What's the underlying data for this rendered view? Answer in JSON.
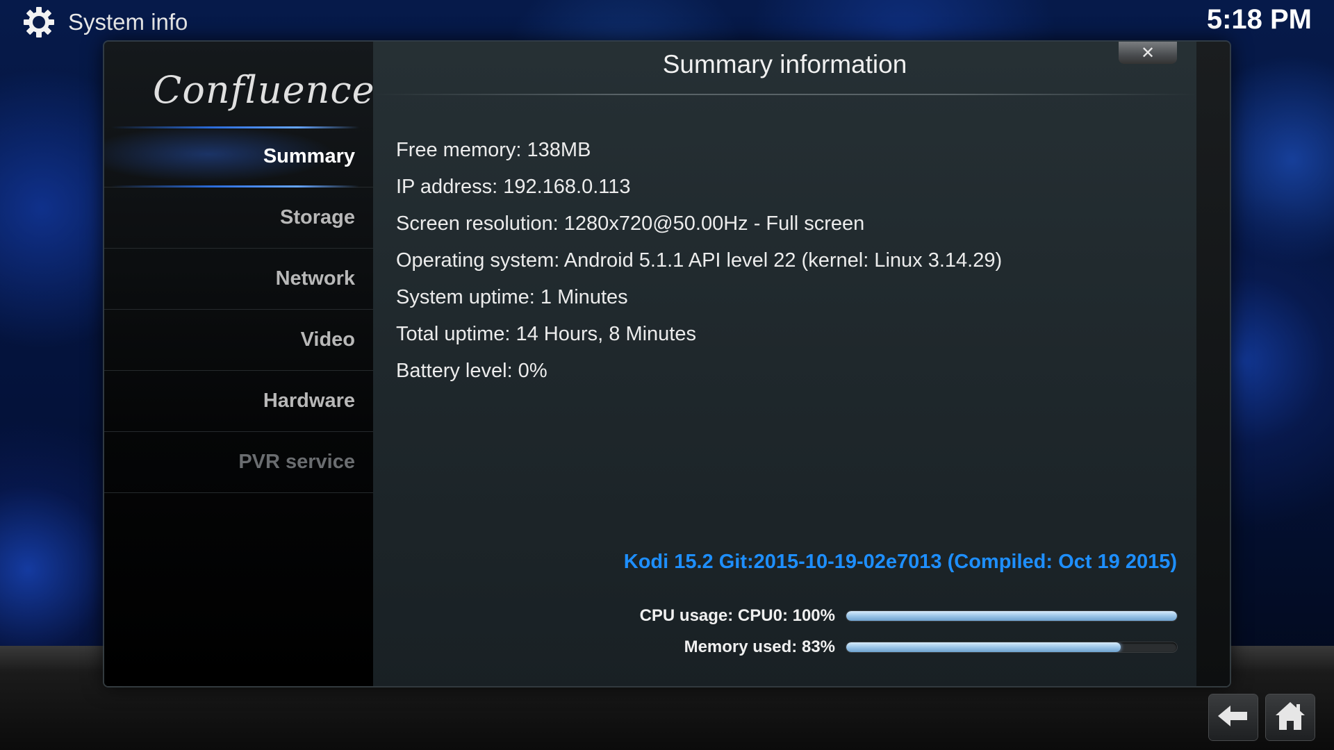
{
  "header": {
    "title": "System info",
    "time": "5:18 PM",
    "icon": "gear-icon"
  },
  "dialog": {
    "logo_text": "Confluence",
    "title": "Summary information",
    "close_label": "✕",
    "nav": [
      {
        "label": "Summary",
        "state": "active"
      },
      {
        "label": "Storage",
        "state": "normal"
      },
      {
        "label": "Network",
        "state": "normal"
      },
      {
        "label": "Video",
        "state": "normal"
      },
      {
        "label": "Hardware",
        "state": "normal"
      },
      {
        "label": "PVR service",
        "state": "disabled"
      }
    ],
    "info": [
      "Free memory: 138MB",
      "IP address: 192.168.0.113",
      "Screen resolution: 1280x720@50.00Hz - Full screen",
      "Operating system: Android 5.1.1 API level 22 (kernel: Linux 3.14.29)",
      "System uptime: 1 Minutes",
      "Total uptime: 14 Hours, 8 Minutes",
      "Battery level: 0%"
    ],
    "version": "Kodi 15.2 Git:2015-10-19-02e7013 (Compiled: Oct 19 2015)",
    "usage": [
      {
        "label": "CPU usage: CPU0: 100%",
        "fraction": 1.0
      },
      {
        "label": "Memory used: 83%",
        "fraction": 0.83
      }
    ]
  },
  "bottom_nav": {
    "back_icon": "back-arrow-icon",
    "home_icon": "home-icon"
  },
  "colors": {
    "accent": "#1e8fff",
    "text": "#ececec",
    "disabled": "#6a6d70"
  }
}
